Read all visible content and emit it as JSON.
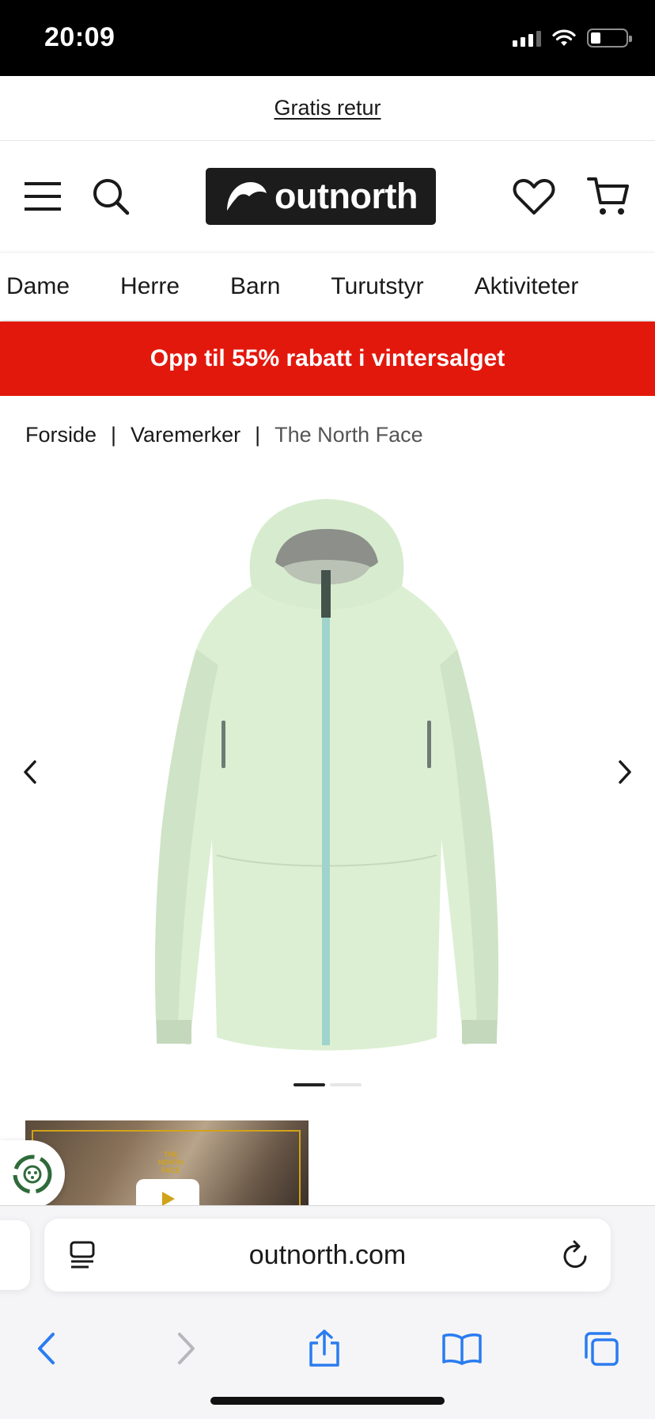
{
  "status_bar": {
    "time": "20:09"
  },
  "promo": {
    "free_returns": "Gratis retur"
  },
  "header": {
    "logo_text": "outnorth"
  },
  "nav": {
    "items": [
      "Dame",
      "Herre",
      "Barn",
      "Turutstyr",
      "Aktiviteter"
    ]
  },
  "sale_banner": {
    "text": "Opp til 55% rabatt i vintersalget",
    "color": "#e3180d"
  },
  "breadcrumb": {
    "items": [
      "Forside",
      "Varemerker",
      "The North Face"
    ],
    "separator": "|"
  },
  "gallery": {
    "image_count": 2,
    "active_index": 0,
    "product_color": "#dcefd3",
    "zipper_color": "#9fd3cc"
  },
  "video": {
    "brand_mark": "THE NORTH FACE"
  },
  "browser": {
    "url": "outnorth.com"
  },
  "icons": {
    "menu": "hamburger-icon",
    "search": "search-icon",
    "wishlist": "heart-icon",
    "cart": "cart-icon",
    "prev": "chevron-left-icon",
    "next": "chevron-right-icon",
    "reader": "reader-icon",
    "reload": "reload-icon",
    "back": "back-icon",
    "forward": "forward-icon",
    "share": "share-icon",
    "bookmarks": "bookmarks-icon",
    "tabs": "tabs-icon"
  }
}
